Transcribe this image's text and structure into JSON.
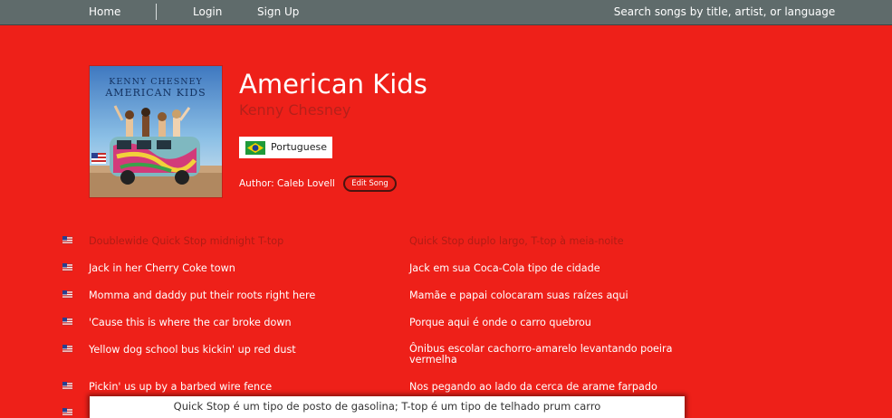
{
  "nav": {
    "home": "Home",
    "login": "Login",
    "signup": "Sign Up",
    "search_placeholder": "Search songs by title, artist, or language"
  },
  "song": {
    "title": "American Kids",
    "artist": "Kenny Chesney",
    "cover_artist_text": "KENNY CHESNEY",
    "cover_title_text": "AMERICAN KIDS",
    "language": "Portuguese",
    "language_flag": "brazil-flag-icon",
    "author": "Author: Caleb Lovell",
    "edit_label": "Edit Song"
  },
  "lyrics": [
    {
      "original": "Doublewide Quick Stop midnight T-top",
      "translation": "Quick Stop duplo largo, T-top à meia-noite",
      "highlighted": true
    },
    {
      "original": "Jack in her Cherry Coke town",
      "translation": "Jack em sua Coca-Cola tipo de cidade",
      "highlighted": false
    },
    {
      "original": "Momma and daddy put their roots right here",
      "translation": "Mamãe e papai colocaram suas raízes aqui",
      "highlighted": false
    },
    {
      "original": "'Cause this is where the car broke down",
      "translation": "Porque aqui é onde o carro quebrou",
      "highlighted": false
    },
    {
      "original": "Yellow dog school bus kickin' up red dust",
      "translation": "Ônibus escolar cachorro-amarelo levantando poeira vermelha",
      "highlighted": false
    },
    {
      "original": "Pickin' us up by a barbed wire fence",
      "translation": "Nos pegando ao lado da cerca de arame farpado",
      "highlighted": false
    }
  ],
  "note": "Quick Stop é um tipo de posto de gasolina; T-top é um tipo de telhado prum carro",
  "colors": {
    "background": "#ee2019",
    "navbar": "#5f6b6b",
    "highlight_text": "#b01c15",
    "artist_text": "#b5201a"
  }
}
